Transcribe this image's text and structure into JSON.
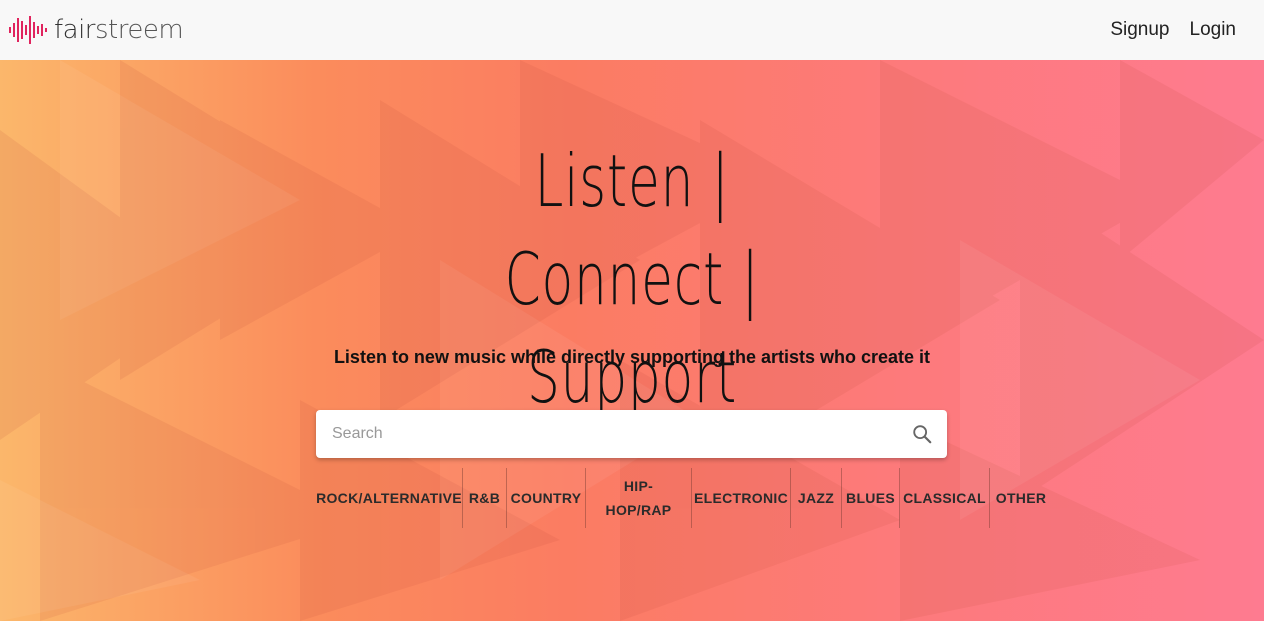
{
  "brand": {
    "part1": "fair",
    "part2": "streem"
  },
  "nav": {
    "signup": "Signup",
    "login": "Login"
  },
  "hero": {
    "title_line1": "Listen | Connect |",
    "title_line2": "Support",
    "subtitle": "Listen to new music while directly supporting the artists who create it"
  },
  "search": {
    "placeholder": "Search",
    "value": "",
    "icon": "search-icon"
  },
  "genres": [
    "ROCK/ALTERNATIVE",
    "R&B",
    "COUNTRY",
    "HIP-HOP/RAP",
    "ELECTRONIC",
    "JAZZ",
    "BLUES",
    "CLASSICAL",
    "OTHER"
  ],
  "colors": {
    "brand_accent": "#e0245e",
    "gradient_left": "#fbb76b",
    "gradient_right": "#fe7b90"
  }
}
